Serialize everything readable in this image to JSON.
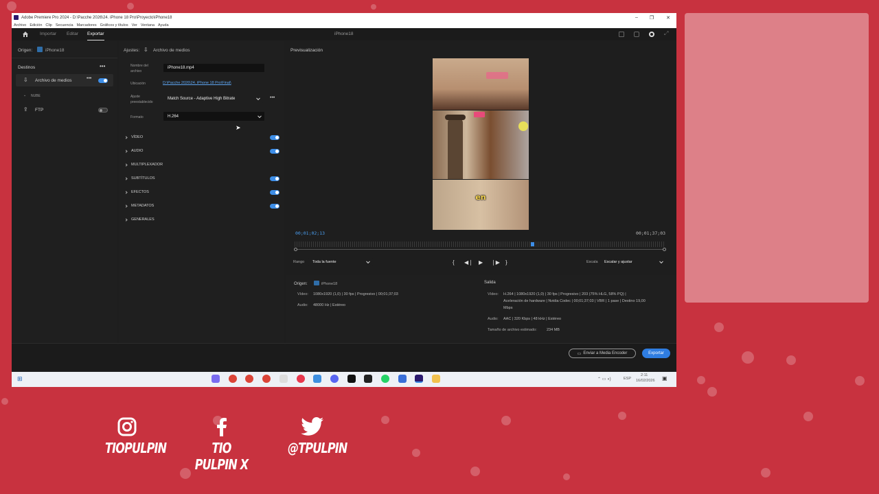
{
  "window": {
    "title": "Adobe Premiere Pro 2024 - D:\\Pacche 2026\\24. iPhone 18 Pro\\Proyecto\\iPhone18",
    "controls": [
      "–",
      "❐",
      "✕"
    ]
  },
  "menu": [
    "Archivo",
    "Edición",
    "Clip",
    "Secuencia",
    "Marcadores",
    "Gráficos y títulos",
    "Ver",
    "Ventana",
    "Ayuda"
  ],
  "app_tabs": {
    "import": "Importar",
    "edit": "Editar",
    "export": "Exportar"
  },
  "project_name": "iPhone18",
  "source": {
    "label": "Origen:",
    "name": "iPhone18"
  },
  "destinations": {
    "title": "Destinos",
    "media_file": "Archivo de medios",
    "cloud_header": "NUBE",
    "ftp": "FTP"
  },
  "settings": {
    "label": "Ajustes:",
    "target": "Archivo de medios",
    "file_name_label": "Nombre del archivo",
    "file_name": "iPhone18.mp4",
    "location_label": "Ubicación",
    "location": "D:\\Pacche 2026\\24. iPhone 18 Pro\\Final\\",
    "preset_label": "Ajuste preestablecido",
    "preset": "Match Source - Adaptive High Bitrate",
    "format_label": "Formato",
    "format": "H.264",
    "sections": [
      "VÍDEO",
      "AUDIO",
      "MULTIPLEXADOR",
      "SUBTÍTULOS",
      "EFECTOS",
      "METADATOS",
      "GENERALES"
    ]
  },
  "preview": {
    "title": "Previsualización",
    "caption": "en",
    "timecode_current": "00;01;02;13",
    "timecode_total": "00;01;37;03",
    "range_label": "Rango",
    "range_value": "Toda la fuente",
    "scale_label": "Escala",
    "scale_value": "Escalar y ajustar",
    "playhead_fraction": 0.64
  },
  "summary": {
    "source_label": "Origen:",
    "source_name": "iPhone18",
    "video_label": "Vídeo:",
    "video_info": "1080x1920 (1,0)  |  30 fps  |  Progresivo  |  00;01;37;03",
    "audio_label": "Audio:",
    "audio_info": "48000 Hz  |  Estéreo",
    "output_label": "Salida",
    "out_video_lines": [
      "H.264  |  1080x1920 (1,0)  |  30 fps  |  Progresivo  |  203 (75% HLG, 58% PQ)  |",
      "Aceleración de hardware  |  Nvidia Codec  |  00;01;37;03  |  VBR  |  1 pase  |  Destino 19,00",
      "Mbps"
    ],
    "out_audio": "AAC  |  320 Kbps  |  48 kHz  |  Estéreo",
    "file_size_label": "Tamaño de archivo estimado:",
    "file_size": "234 MB"
  },
  "buttons": {
    "media_encoder": "Enviar a Media Encoder",
    "export": "Exportar"
  },
  "taskbar": {
    "lang": "ESP",
    "time": "2:11",
    "date": "16/02/2026"
  },
  "socials": [
    {
      "icon": "instagram-icon",
      "handle": "TIOPULPIN"
    },
    {
      "icon": "facebook-icon",
      "handle": "TIO PULPIN X"
    },
    {
      "icon": "twitter-icon",
      "handle": "@TPULPIN"
    }
  ],
  "colors": {
    "background": "#c8323f",
    "accent": "#3d8ee8",
    "panel": "#1f1f1f"
  }
}
